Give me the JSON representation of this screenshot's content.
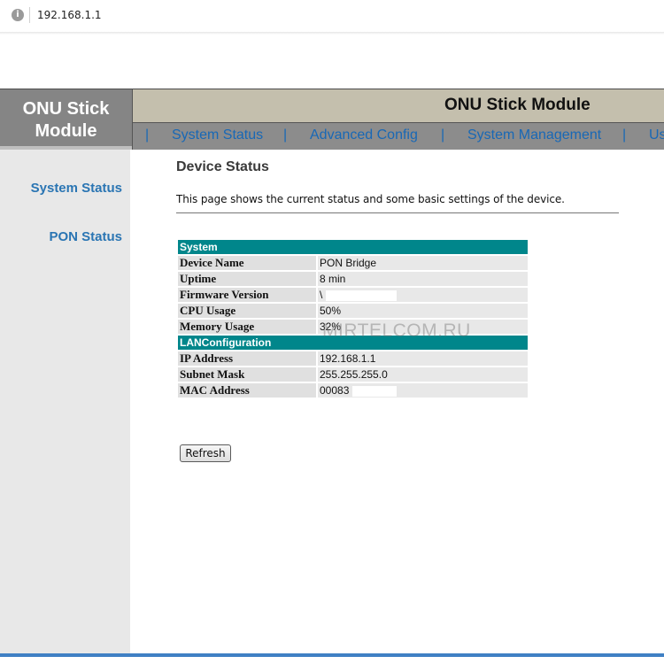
{
  "browser": {
    "url": "192.168.1.1",
    "info_icon": "i"
  },
  "logo": {
    "line1": "ONU Stick",
    "line2": "Module"
  },
  "header": {
    "title": "ONU Stick Module"
  },
  "nav": {
    "separator": "|",
    "items": [
      {
        "label": "System Status"
      },
      {
        "label": "Advanced Config"
      },
      {
        "label": "System Management"
      },
      {
        "label": "Us"
      }
    ]
  },
  "sidebar": {
    "items": [
      {
        "label": "System Status"
      },
      {
        "label": "PON Status"
      }
    ]
  },
  "content": {
    "title": "Device Status",
    "description": "This page shows the current status and some basic settings of the device.",
    "refresh_label": "Refresh"
  },
  "system": {
    "heading": "System",
    "rows": [
      {
        "label": "Device Name",
        "value": "PON Bridge"
      },
      {
        "label": "Uptime",
        "value": "8 min"
      },
      {
        "label": "Firmware Version",
        "value": "\\"
      },
      {
        "label": "CPU Usage",
        "value": "50%"
      },
      {
        "label": "Memory Usage",
        "value": "32%"
      }
    ]
  },
  "lan": {
    "heading": "LANConfiguration",
    "rows": [
      {
        "label": "IP Address",
        "value": "192.168.1.1"
      },
      {
        "label": "Subnet Mask",
        "value": "255.255.255.0"
      },
      {
        "label": "MAC Address",
        "value": "00083"
      }
    ]
  },
  "watermark": "MIRTELCOM.RU",
  "colors": {
    "section_header": "#00868b",
    "nav_link": "#1868b6",
    "header_bg": "#c4bfad",
    "logo_bg": "#858585"
  }
}
